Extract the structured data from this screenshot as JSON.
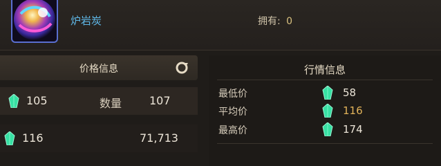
{
  "item": {
    "name": "炉岩炭",
    "owned_label": "拥有:",
    "owned_value": "0"
  },
  "price_panel": {
    "title": "价格信息",
    "row1": {
      "price": "105",
      "qty_label": "数量",
      "qty": "107"
    },
    "row2": {
      "price": "116",
      "amount": "71,713"
    }
  },
  "market_panel": {
    "title": "行情信息",
    "rows": [
      {
        "label": "最低价",
        "value": "58"
      },
      {
        "label": "平均价",
        "value": "116"
      },
      {
        "label": "最高价",
        "value": "174"
      }
    ]
  },
  "icons": {
    "item": "lava-orb-icon",
    "currency": "green-gem-icon",
    "refresh": "refresh-icon"
  }
}
